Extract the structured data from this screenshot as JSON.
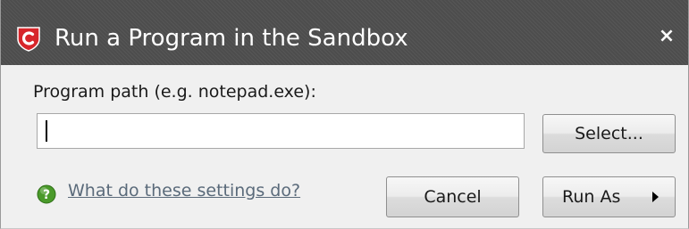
{
  "window": {
    "title": "Run a Program in the Sandbox",
    "close_glyph": "×",
    "app_icon": "comodo-shield-icon"
  },
  "form": {
    "path_label": "Program path (e.g. notepad.exe):",
    "path_value": "",
    "select_button": "Select..."
  },
  "footer": {
    "help_icon": "question-icon",
    "help_link": "What do these settings do?",
    "cancel_button": "Cancel",
    "run_as_button": "Run As"
  },
  "colors": {
    "titlebar": "#4d4d4d",
    "brand_red": "#d7262b",
    "help_green": "#4a9a2a",
    "link": "#5a6a7a"
  }
}
